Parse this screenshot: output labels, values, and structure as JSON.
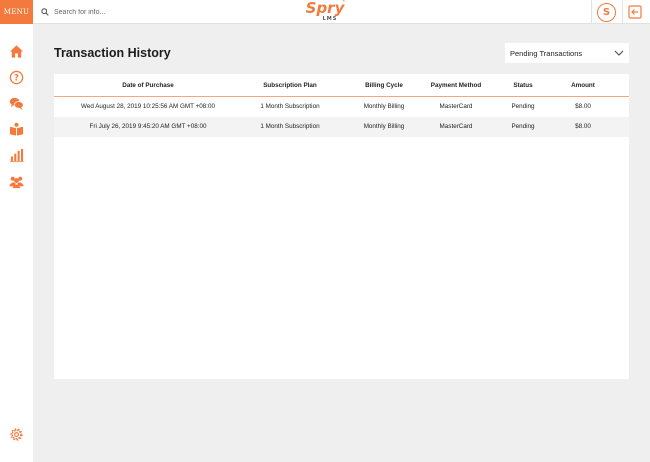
{
  "topbar": {
    "menu_label": "MENU",
    "search_placeholder": "Search for info...",
    "logo_text": "Spry",
    "logo_star": "*",
    "logo_sub": "LMS",
    "badge_glyph": "S"
  },
  "sidebar": {
    "items": [
      {
        "icon": "home-icon"
      },
      {
        "icon": "question-icon"
      },
      {
        "icon": "chat-icon"
      },
      {
        "icon": "book-icon"
      },
      {
        "icon": "bar-chart-icon"
      },
      {
        "icon": "users-icon"
      }
    ],
    "bottom_icon": "gear-icon"
  },
  "page": {
    "title": "Transaction History",
    "filter_value": "Pending Transactions"
  },
  "table": {
    "columns": [
      "Date of Purchase",
      "Subscription Plan",
      "Billing Cycle",
      "Payment Method",
      "Status",
      "Amount"
    ],
    "rows": [
      [
        "Wed August 28, 2019 10:25:56 AM GMT +08:00",
        "1 Month Subscription",
        "Monthly Billing",
        "MasterCard",
        "Pending",
        "$8.00"
      ],
      [
        "Fri July 26, 2019 9:45:20 AM GMT +08:00",
        "1 Month Subscription",
        "Monthly Billing",
        "MasterCard",
        "Pending",
        "$8.00"
      ]
    ]
  },
  "colors": {
    "accent": "#f37a3c",
    "background": "#efefef"
  }
}
